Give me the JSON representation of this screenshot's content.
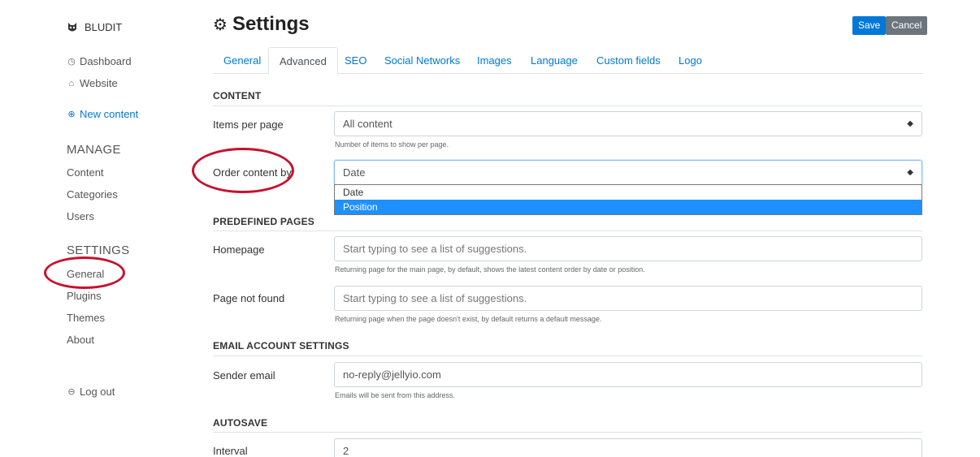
{
  "brand": {
    "name": "BLUDIT"
  },
  "sidebar": {
    "links": [
      {
        "label": "Dashboard",
        "icon": "dashboard-icon"
      },
      {
        "label": "Website",
        "icon": "home-icon"
      },
      {
        "label": "New content",
        "icon": "plus-circle-icon"
      }
    ],
    "manage_title": "MANAGE",
    "manage_items": [
      "Content",
      "Categories",
      "Users"
    ],
    "settings_title": "SETTINGS",
    "settings_items": [
      "General",
      "Plugins",
      "Themes",
      "About"
    ],
    "logout": {
      "label": "Log out",
      "icon": "logout-icon"
    }
  },
  "header": {
    "title": "Settings",
    "icon": "gear-icon",
    "save_label": "Save",
    "cancel_label": "Cancel"
  },
  "tabs": [
    "General",
    "Advanced",
    "SEO",
    "Social Networks",
    "Images",
    "Language",
    "Custom fields",
    "Logo"
  ],
  "active_tab": "Advanced",
  "content": {
    "title": "CONTENT",
    "items_per_page": {
      "label": "Items per page",
      "value": "All content",
      "hint": "Number of items to show per page."
    },
    "order_by": {
      "label": "Order content by",
      "value": "Date",
      "options": [
        "Date",
        "Position"
      ],
      "highlighted": "Position"
    }
  },
  "predefined": {
    "title": "PREDEFINED PAGES",
    "homepage": {
      "label": "Homepage",
      "placeholder": "Start typing to see a list of suggestions.",
      "hint": "Returning page for the main page, by default, shows the latest content order by date or position."
    },
    "not_found": {
      "label": "Page not found",
      "placeholder": "Start typing to see a list of suggestions.",
      "hint": "Returning page when the page doesn't exist, by default returns a default message."
    }
  },
  "email": {
    "title": "EMAIL ACCOUNT SETTINGS",
    "sender": {
      "label": "Sender email",
      "value": "no-reply@jellyio.com",
      "hint": "Emails will be sent from this address."
    }
  },
  "autosave": {
    "title": "AUTOSAVE",
    "interval": {
      "label": "Interval",
      "value": "2"
    }
  },
  "colors": {
    "accent": "#0078d7",
    "annotation": "#c8102e",
    "highlight": "#1e90ff"
  }
}
